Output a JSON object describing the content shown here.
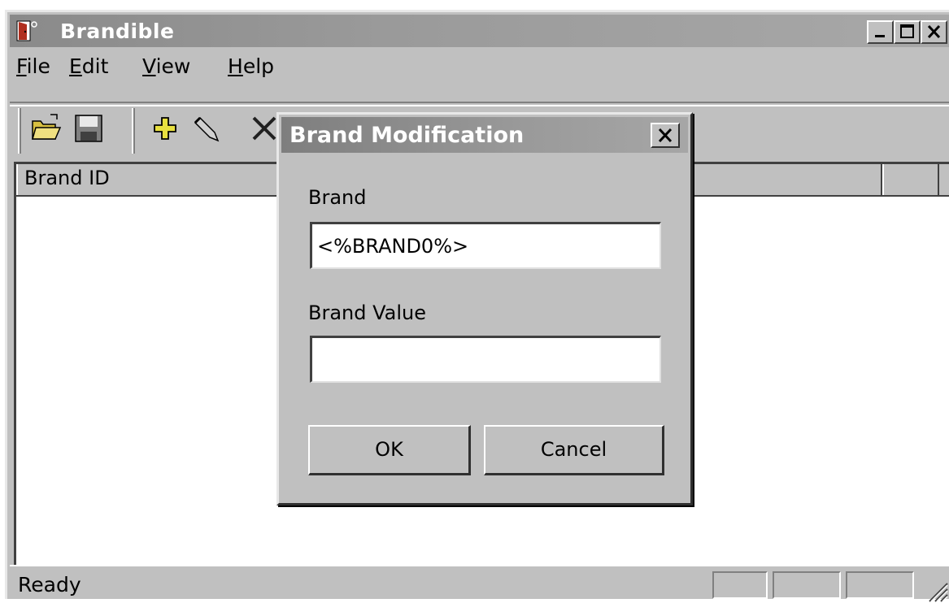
{
  "window": {
    "title": "Brandible",
    "controls": [
      "minimize-icon",
      "maximize-icon",
      "close-icon"
    ]
  },
  "menu": {
    "items": [
      {
        "label": "File",
        "mnemonic": "F",
        "rest": "ile"
      },
      {
        "label": "Edit",
        "mnemonic": "E",
        "rest": "dit"
      },
      {
        "label": "View",
        "mnemonic": "V",
        "rest": "iew"
      },
      {
        "label": "Help",
        "mnemonic": "H",
        "rest": "elp"
      }
    ]
  },
  "toolbar": {
    "buttons": [
      "open-folder-icon",
      "save-disk-icon",
      "add-plus-icon",
      "edit-pen-icon",
      "delete-x-icon"
    ]
  },
  "list": {
    "columns": [
      "Brand ID",
      "",
      ""
    ],
    "rows": []
  },
  "status": {
    "text": "Ready"
  },
  "dialog": {
    "title": "Brand Modification",
    "brand_label": "Brand",
    "brand_value": "<%BRAND0%>",
    "brand_value_label": "Brand Value",
    "brand_value_value": "",
    "ok_label": "OK",
    "cancel_label": "Cancel"
  }
}
